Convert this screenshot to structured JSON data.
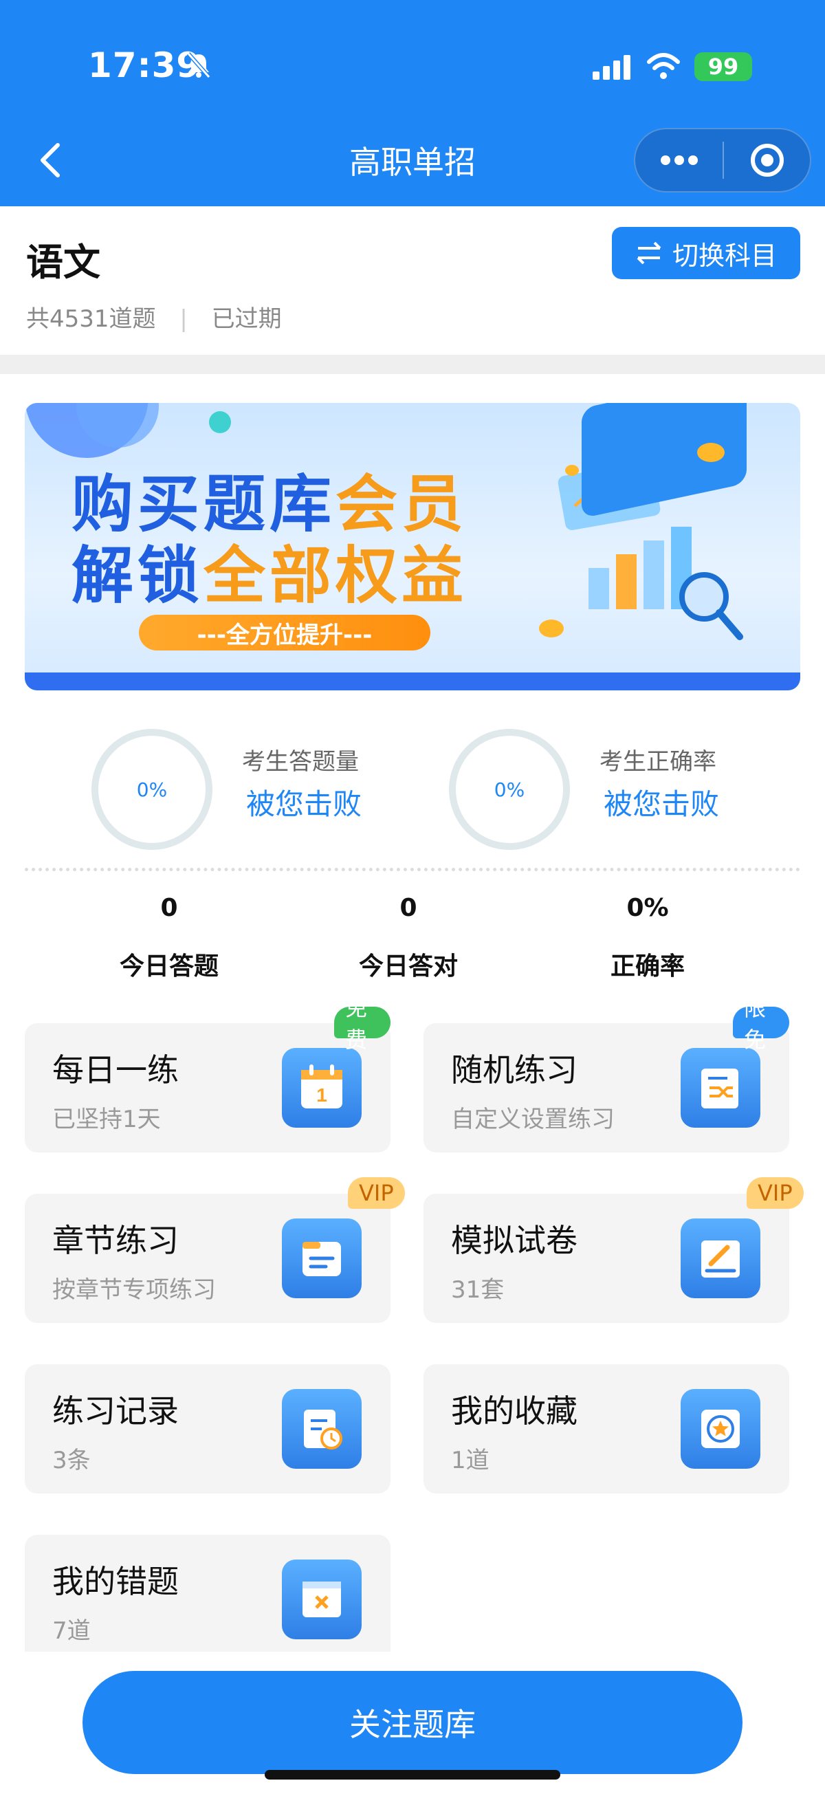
{
  "status": {
    "time": "17:39",
    "battery": "99"
  },
  "nav": {
    "title": "高职单招"
  },
  "subject": {
    "title": "语文",
    "count": "共4531道题",
    "divider": "|",
    "state": "已过期",
    "switch_label": "切换科目"
  },
  "banner": {
    "line1a": "购买题库",
    "line1b": "会员",
    "line2a": "解锁",
    "line2b": "全部权益",
    "pill": "---全方位提升---"
  },
  "rings": [
    {
      "value": "0%",
      "label": "考生答题量",
      "beat": "被您击败"
    },
    {
      "value": "0%",
      "label": "考生正确率",
      "beat": "被您击败"
    }
  ],
  "stats": [
    {
      "value": "0",
      "label": "今日答题"
    },
    {
      "value": "0",
      "label": "今日答对"
    },
    {
      "value": "0%",
      "label": "正确率"
    }
  ],
  "cards": [
    {
      "title": "每日一练",
      "sub": "已坚持1天",
      "badge": "免费",
      "icon": "calendar-icon"
    },
    {
      "title": "随机练习",
      "sub": "自定义设置练习",
      "badge": "限免",
      "icon": "shuffle-icon"
    },
    {
      "title": "章节练习",
      "sub": "按章节专项练习",
      "badge": "VIP",
      "icon": "folder-icon"
    },
    {
      "title": "模拟试卷",
      "sub": "31套",
      "badge": "VIP",
      "icon": "pen-paper-icon"
    },
    {
      "title": "练习记录",
      "sub": "3条",
      "badge": "",
      "icon": "record-clock-icon"
    },
    {
      "title": "我的收藏",
      "sub": "1道",
      "badge": "",
      "icon": "star-icon"
    },
    {
      "title": "我的错题",
      "sub": "7道",
      "badge": "",
      "icon": "error-icon"
    }
  ],
  "footer": {
    "follow_label": "关注题库"
  },
  "colors": {
    "primary": "#1f86f5",
    "green": "#3fc25b",
    "vip": "#ffd27a"
  }
}
